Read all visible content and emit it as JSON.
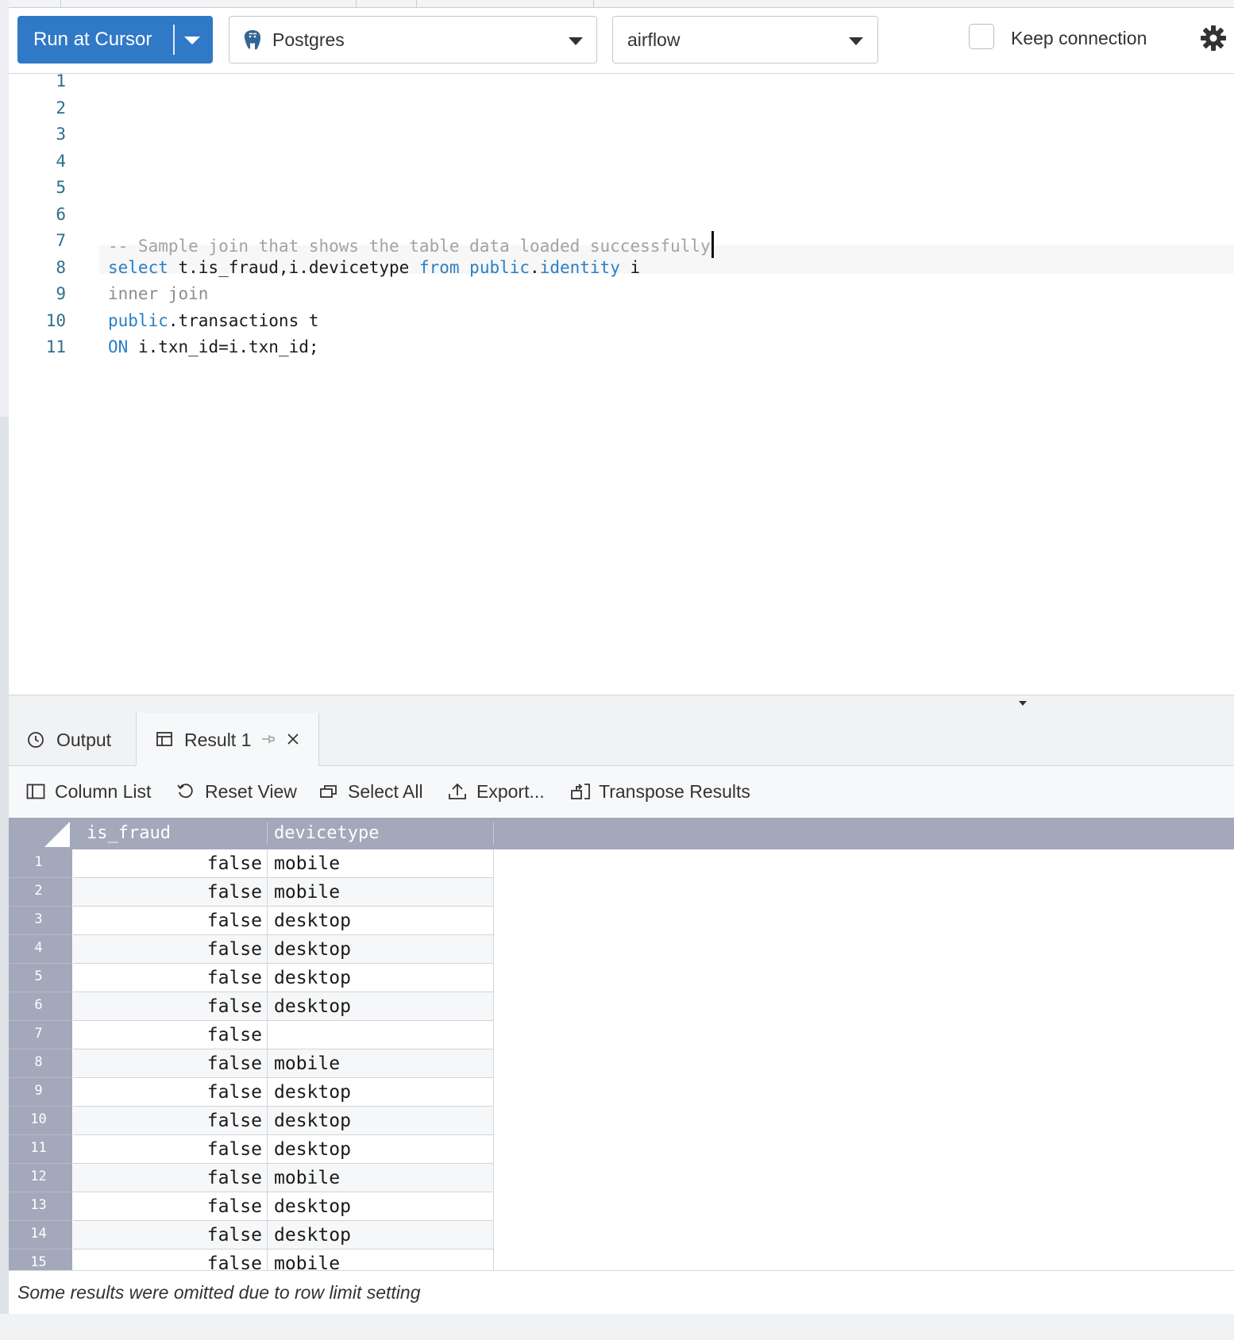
{
  "toolbar": {
    "run_label": "Run at Cursor",
    "datasource": "Postgres",
    "database": "airflow",
    "keep_connection_label": "Keep connection"
  },
  "editor": {
    "line_numbers": [
      "1",
      "2",
      "3",
      "4",
      "5",
      "6",
      "7",
      "8",
      "9",
      "10",
      "11"
    ],
    "comment": "-- Sample join that shows the table data loaded successfully",
    "line8": {
      "kw_select": "select",
      "cols": " t.is_fraud,i.devicetype ",
      "kw_from": "from",
      "sp": " ",
      "schema": "public",
      "dot": ".",
      "table": "identity",
      "alias": " i"
    },
    "line9": "inner join",
    "line10": {
      "schema": "public",
      "rest": ".transactions t"
    },
    "line11": {
      "kw_on": "ON",
      "rest": " i.txn_id=i.txn_id;"
    }
  },
  "result_tabs": {
    "output_label": "Output",
    "result_label": "Result 1"
  },
  "actions": {
    "column_list": "Column List",
    "reset_view": "Reset View",
    "select_all": "Select All",
    "export": "Export...",
    "transpose": "Transpose Results"
  },
  "grid": {
    "columns": [
      "is_fraud",
      "devicetype"
    ],
    "rows": [
      {
        "n": "1",
        "is_fraud": "false",
        "devicetype": "mobile"
      },
      {
        "n": "2",
        "is_fraud": "false",
        "devicetype": "mobile"
      },
      {
        "n": "3",
        "is_fraud": "false",
        "devicetype": "desktop"
      },
      {
        "n": "4",
        "is_fraud": "false",
        "devicetype": "desktop"
      },
      {
        "n": "5",
        "is_fraud": "false",
        "devicetype": "desktop"
      },
      {
        "n": "6",
        "is_fraud": "false",
        "devicetype": "desktop"
      },
      {
        "n": "7",
        "is_fraud": "false",
        "devicetype": ""
      },
      {
        "n": "8",
        "is_fraud": "false",
        "devicetype": "mobile"
      },
      {
        "n": "9",
        "is_fraud": "false",
        "devicetype": "desktop"
      },
      {
        "n": "10",
        "is_fraud": "false",
        "devicetype": "desktop"
      },
      {
        "n": "11",
        "is_fraud": "false",
        "devicetype": "desktop"
      },
      {
        "n": "12",
        "is_fraud": "false",
        "devicetype": "mobile"
      },
      {
        "n": "13",
        "is_fraud": "false",
        "devicetype": "desktop"
      },
      {
        "n": "14",
        "is_fraud": "false",
        "devicetype": "desktop"
      },
      {
        "n": "15",
        "is_fraud": "false",
        "devicetype": "mobile"
      }
    ]
  },
  "footer": {
    "message": "Some results were omitted due to row limit setting"
  },
  "colors": {
    "accent": "#3079c7",
    "keyword": "#2a7fc3",
    "grid_header": "#a3a8bb"
  }
}
